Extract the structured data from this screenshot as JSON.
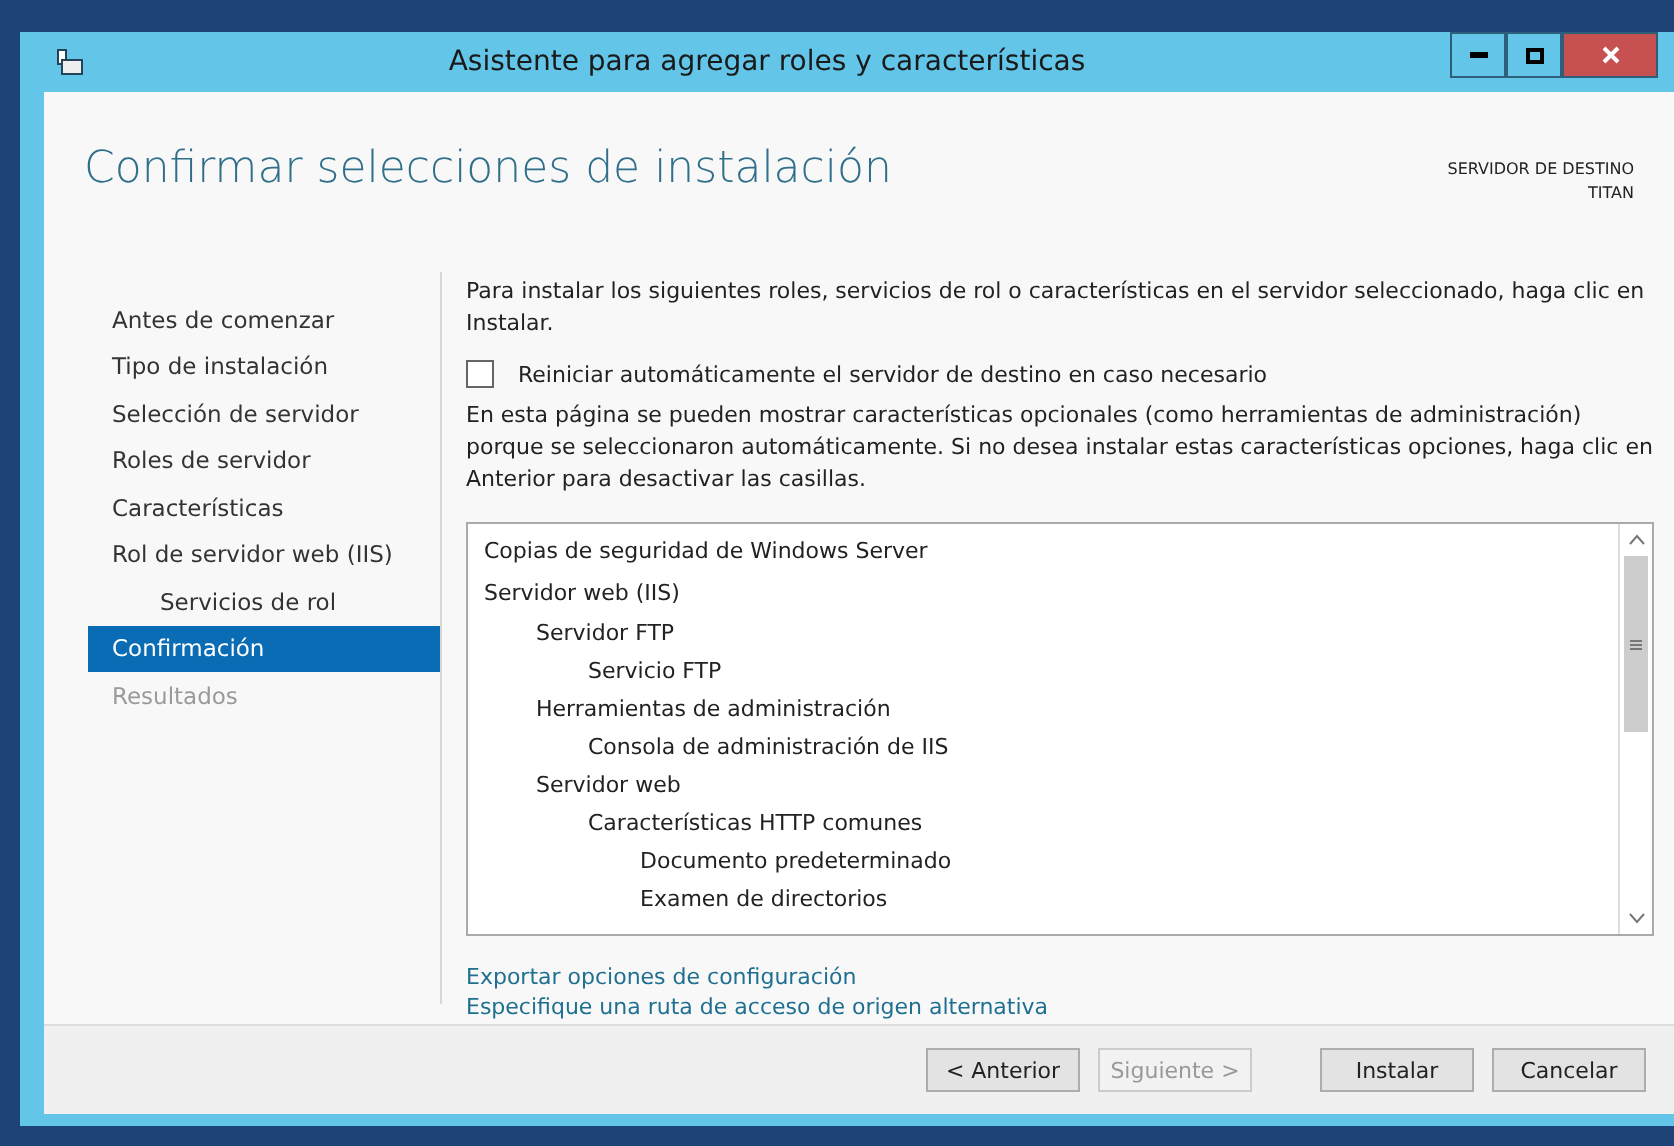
{
  "window": {
    "title": "Asistente para agregar roles y características"
  },
  "header": {
    "title": "Confirmar selecciones de instalación",
    "server_label": "SERVIDOR DE DESTINO",
    "server_name": "TITAN"
  },
  "sidebar": {
    "items": [
      {
        "label": "Antes de comenzar",
        "selected": false,
        "disabled": false
      },
      {
        "label": "Tipo de instalación",
        "selected": false,
        "disabled": false
      },
      {
        "label": "Selección de servidor",
        "selected": false,
        "disabled": false
      },
      {
        "label": "Roles de servidor",
        "selected": false,
        "disabled": false
      },
      {
        "label": "Características",
        "selected": false,
        "disabled": false
      },
      {
        "label": "Rol de servidor web (IIS)",
        "selected": false,
        "disabled": false,
        "children": [
          {
            "label": "Servicios de rol",
            "selected": false,
            "disabled": false
          }
        ]
      },
      {
        "label": "Confirmación",
        "selected": true,
        "disabled": false
      },
      {
        "label": "Resultados",
        "selected": false,
        "disabled": true
      }
    ]
  },
  "intro": "Para instalar los siguientes roles, servicios de rol o características en el servidor seleccionado, haga clic en Instalar.",
  "restart_option": {
    "label": "Reiniciar automáticamente el servidor de destino en caso necesario",
    "checked": false
  },
  "note": "En esta página se pueden mostrar características opcionales (como herramientas de administración) porque se seleccionaron automáticamente. Si no desea instalar estas características opciones, haga clic en Anterior para desactivar las casillas.",
  "selections": [
    {
      "label": "Copias de seguridad de Windows Server"
    },
    {
      "label": "Servidor web (IIS)",
      "children": [
        {
          "label": "Servidor FTP",
          "children": [
            {
              "label": "Servicio FTP"
            }
          ]
        },
        {
          "label": "Herramientas de administración",
          "children": [
            {
              "label": "Consola de administración de IIS"
            }
          ]
        },
        {
          "label": "Servidor web",
          "children": [
            {
              "label": "Características HTTP comunes",
              "children": [
                {
                  "label": "Documento predeterminado"
                },
                {
                  "label": "Examen de directorios"
                }
              ]
            }
          ]
        }
      ]
    }
  ],
  "links": [
    "Exportar opciones de configuración",
    "Especifique una ruta de acceso de origen alternativa"
  ],
  "buttons": [
    {
      "label": "< Anterior",
      "disabled": false
    },
    {
      "label": "Siguiente >",
      "disabled": true
    },
    {
      "label": "Instalar",
      "disabled": false
    },
    {
      "label": "Cancelar",
      "disabled": false
    }
  ]
}
